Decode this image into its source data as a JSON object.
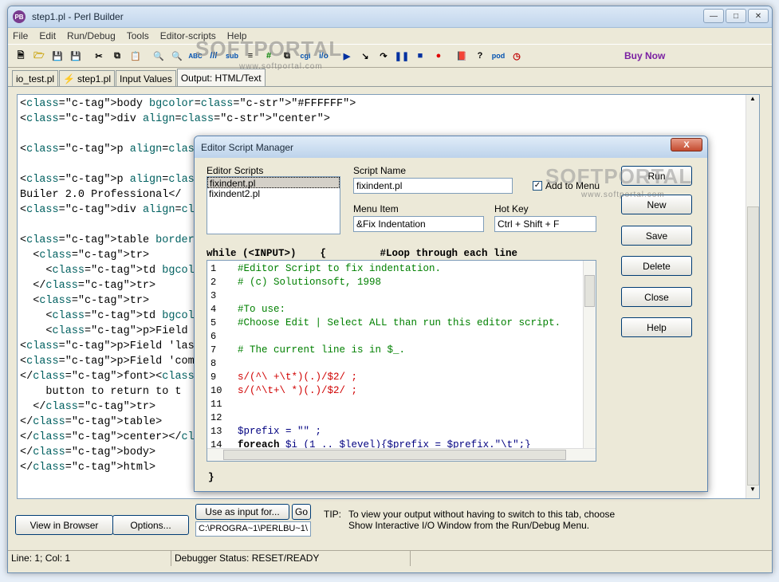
{
  "window": {
    "title": "step1.pl - Perl Builder",
    "app_icon": "PB"
  },
  "menu": [
    "File",
    "Edit",
    "Run/Debug",
    "Tools",
    "Editor-scripts",
    "Help"
  ],
  "toolbar": {
    "buy_now": "Buy Now"
  },
  "tabs": [
    "io_test.pl",
    "step1.pl",
    "Input Values",
    "Output: HTML/Text"
  ],
  "editor": {
    "lines": [
      "<body bgcolor=\"#FFFFFF\">",
      "<div align=\"center\">",
      "",
      "<p align=\"center\"><font ",
      "",
      "<p align=\"center\"><font ",
      "Builer 2.0 Professional</",
      "<div align=\"center\"><cent",
      "",
      "<table border=\"0\" cellpad",
      "  <tr>",
      "    <td bgcolor=\"#000000",
      "  </tr>",
      "  <tr>",
      "    <td bgcolor=\"#008080",
      "    <p>Field 'first' must",
      "<p>Field 'last' must be f",
      "<p>Field 'company' must b",
      "</font><p><font color=\"#",
      "    button to return to t",
      "  </tr>",
      "</table>",
      "</center></div></div>",
      "</body>",
      "</html>"
    ]
  },
  "bottom": {
    "view_in_browser": "View in Browser",
    "options": "Options...",
    "use_as_input": "Use as input for...",
    "go": "Go",
    "path": "C:\\PROGRA~1\\PERLBU~1\\",
    "tip_label": "TIP:",
    "tip_text_1": "To view your output without having to switch to this tab, choose",
    "tip_text_2": "Show Interactive I/O Window from the Run/Debug Menu."
  },
  "status": {
    "position": "Line: 1; Col: 1",
    "debugger": "Debugger Status: RESET/READY"
  },
  "dialog": {
    "title": "Editor Script Manager",
    "close": "X",
    "editor_scripts_label": "Editor Scripts",
    "scripts": [
      "fixindent.pl",
      "fixindent2.pl"
    ],
    "script_name_label": "Script Name",
    "script_name": "fixindent.pl",
    "add_to_menu": "Add to Menu",
    "add_to_menu_checked": true,
    "menu_item_label": "Menu Item",
    "menu_item": "&Fix Indentation",
    "hotkey_label": "Hot Key",
    "hotkey": "Ctrl + Shift + F",
    "header_line": "while (<INPUT>)    {         #Loop through each line",
    "footer_line": "}",
    "buttons": {
      "run": "Run",
      "new": "New",
      "save": "Save",
      "delete": "Delete",
      "close": "Close",
      "help": "Help"
    },
    "line_numbers": [
      "1",
      "2",
      "3",
      "4",
      "5",
      "6",
      "7",
      "8",
      "9",
      "10",
      "11",
      "12",
      "13",
      "14"
    ],
    "code": [
      {
        "t": "#Editor Script to fix indentation.",
        "k": "comment"
      },
      {
        "t": "# (c) Solutionsoft, 1998",
        "k": "comment"
      },
      {
        "t": "",
        "k": "plain"
      },
      {
        "t": "#To use:",
        "k": "comment"
      },
      {
        "t": "#Choose Edit | Select ALL than run this editor script.",
        "k": "comment"
      },
      {
        "t": "",
        "k": "plain"
      },
      {
        "t": "# The current line is in $_.",
        "k": "comment"
      },
      {
        "t": "",
        "k": "plain"
      },
      {
        "t": "s/(^\\ +\\t*)(.)/$2/ ;",
        "k": "regex"
      },
      {
        "t": "s/(^\\t+\\ *)(.)/$2/ ;",
        "k": "regex"
      },
      {
        "t": "",
        "k": "plain"
      },
      {
        "t": "",
        "k": "plain"
      },
      {
        "t": "$prefix = \"\" ;",
        "k": "var"
      },
      {
        "t": "foreach $i (1 .. $level){$prefix = $prefix.\"\\t\";}",
        "k": "plain"
      }
    ]
  },
  "watermark": "SOFTPORTAL",
  "watermark_url": "www.softportal.com"
}
